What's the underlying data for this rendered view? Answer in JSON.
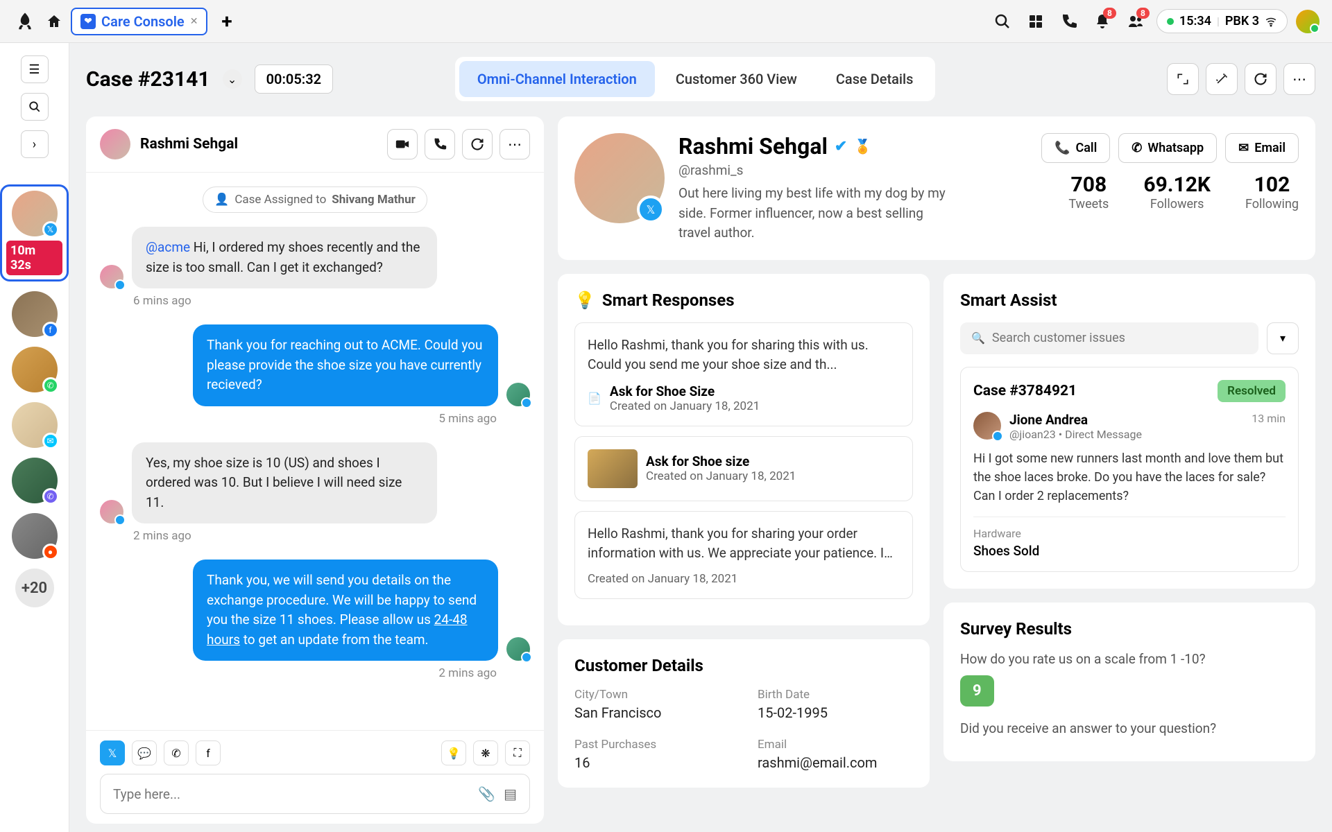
{
  "topbar": {
    "tab_label": "Care Console",
    "time": "15:34",
    "network": "PBK 3",
    "notif_badge": "8",
    "people_badge": "8"
  },
  "rail": {
    "active_timer": "10m 32s",
    "more_count": "+20"
  },
  "header": {
    "case_title": "Case #23141",
    "timer": "00:05:32",
    "tabs": [
      "Omni-Channel Interaction",
      "Customer 360 View",
      "Case Details"
    ]
  },
  "chat": {
    "name": "Rashmi Sehgal",
    "assigned_prefix": "Case Assigned to ",
    "assigned_to": "Shivang Mathur",
    "messages": [
      {
        "dir": "in",
        "mention": "@acme",
        "text": " Hi, I ordered my shoes recently and the size is too small. Can I get it exchanged?",
        "ts": "6 mins ago"
      },
      {
        "dir": "out",
        "text": "Thank you for reaching out to ACME. Could you please provide the shoe size you have currently recieved?",
        "ts": "5 mins ago"
      },
      {
        "dir": "in",
        "text": "Yes, my shoe size is 10 (US) and shoes I ordered was 10. But I believe I will need size 11.",
        "ts": "2 mins ago"
      },
      {
        "dir": "out",
        "text_a": "Thank you, we will send you details on the exchange procedure. We will be happy to send you the size 11 shoes. Please allow us ",
        "link": "24-48 hours",
        "text_b": " to get an update from the team.",
        "ts": "2 mins ago"
      }
    ],
    "input_placeholder": "Type here..."
  },
  "profile": {
    "name": "Rashmi Sehgal",
    "handle": "@rashmi_s",
    "bio": "Out here living my best life with my dog by my side. Former influencer, now a best selling travel author.",
    "actions": {
      "call": "Call",
      "whatsapp": "Whatsapp",
      "email": "Email"
    },
    "stats": [
      {
        "n": "708",
        "l": "Tweets"
      },
      {
        "n": "69.12K",
        "l": "Followers"
      },
      {
        "n": "102",
        "l": "Following"
      }
    ]
  },
  "smart_responses": {
    "title": "Smart Responses",
    "items": [
      {
        "text": "Hello Rashmi, thank you for sharing this with us. Could you send me your shoe size and th...",
        "title": "Ask for Shoe Size",
        "date": "Created on January 18, 2021",
        "thumb": false,
        "icon": true
      },
      {
        "text": "",
        "title": "Ask for Shoe size",
        "date": "Created on January 18, 2021",
        "thumb": true,
        "icon": false
      },
      {
        "text": "Hello Rashmi, thank you for sharing your order information with us. We appreciate your patience. I hope we were able to solve your...",
        "title": "",
        "date": "Created on January 18, 2021",
        "thumb": false,
        "icon": false
      }
    ]
  },
  "customer_details": {
    "title": "Customer Details",
    "fields": [
      {
        "l": "City/Town",
        "v": "San Francisco"
      },
      {
        "l": "Birth Date",
        "v": "15-02-1995"
      },
      {
        "l": "Past Purchases",
        "v": "16"
      },
      {
        "l": "Email",
        "v": "rashmi@email.com"
      }
    ]
  },
  "smart_assist": {
    "title": "Smart Assist",
    "search_placeholder": "Search customer issues",
    "case": {
      "id": "Case #3784921",
      "status": "Resolved",
      "user": "Jione Andrea",
      "handle": "@jioan23 • Direct Message",
      "time": "13 min",
      "text": "Hi I got some new runners last month and love them but the shoe laces broke. Do you have the laces for sale? Can I order 2 replacements?",
      "tag_label": "Hardware",
      "tag_value": "Shoes Sold"
    }
  },
  "survey": {
    "title": "Survey Results",
    "q1": "How do you rate us on a scale from 1 -10?",
    "score": "9",
    "q2": "Did you receive an answer to your question?"
  }
}
